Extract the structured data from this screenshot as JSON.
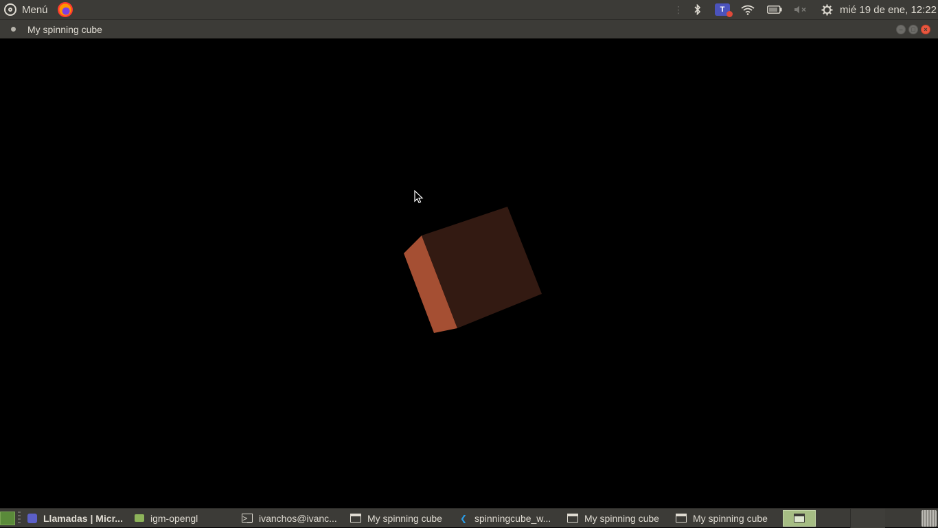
{
  "top_panel": {
    "menu_label": "Menú",
    "clock": "mié 19 de ene, 12:22",
    "icons": [
      "ubuntu-logo-icon",
      "firefox-icon",
      "bluetooth-icon",
      "teams-icon",
      "wifi-icon",
      "battery-icon",
      "volume-muted-icon",
      "settings-gear-icon"
    ]
  },
  "window": {
    "title": "My spinning cube",
    "controls": [
      "minimize",
      "maximize",
      "close"
    ]
  },
  "canvas": {
    "background": "#000000",
    "cube_front_color": "#331a12",
    "cube_side_color": "#a54f33"
  },
  "taskbar": {
    "items": [
      {
        "label": "Llamadas | Micr...",
        "icon": "teams-icon",
        "bold": true
      },
      {
        "label": "igm-opengl",
        "icon": "folder-icon",
        "bold": false
      },
      {
        "label": "ivanchos@ivanc...",
        "icon": "terminal-icon",
        "bold": false
      },
      {
        "label": "My spinning cube",
        "icon": "window-icon",
        "bold": false
      },
      {
        "label": "spinningcube_w...",
        "icon": "vscode-icon",
        "bold": false
      },
      {
        "label": "My spinning cube",
        "icon": "window-icon",
        "bold": false
      },
      {
        "label": "My spinning cube",
        "icon": "window-icon",
        "bold": false
      }
    ]
  }
}
